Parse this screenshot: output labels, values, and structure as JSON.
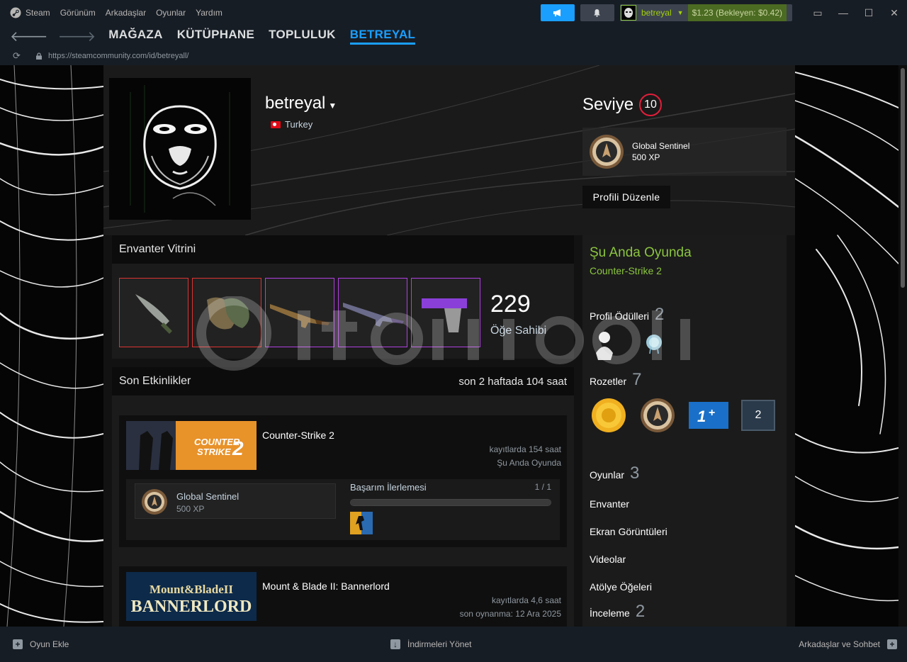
{
  "titlebar": {
    "menu": [
      "Steam",
      "Görünüm",
      "Arkadaşlar",
      "Oyunlar",
      "Yardım"
    ],
    "account_name": "betreyal",
    "wallet": "$1.23 (Bekleyen: $0.42)"
  },
  "nav": {
    "tabs": [
      "MAĞAZA",
      "KÜTÜPHANE",
      "TOPLULUK",
      "BETREYAL"
    ],
    "url": "https://steamcommunity.com/id/betreyall/"
  },
  "profile": {
    "name": "betreyal",
    "country": "Turkey",
    "level_label": "Seviye",
    "level": "10",
    "fav_badge_name": "Global Sentinel",
    "fav_badge_xp": "500 XP",
    "edit_button": "Profili Düzenle"
  },
  "showcase": {
    "title": "Envanter Vitrini",
    "count": "229",
    "count_label": "Öğe Sahibi"
  },
  "activity": {
    "title": "Son Etkinlikler",
    "summary": "son 2 haftada 104 saat",
    "games": [
      {
        "name": "Counter-Strike 2",
        "hours": "kayıtlarda 154 saat",
        "status": "Şu Anda Oyunda",
        "achievement_badge": "Global Sentinel",
        "achievement_xp": "500 XP",
        "achievement_title": "Başarım İlerlemesi",
        "achievement_count": "1 / 1",
        "achievement_progress": 1.0
      },
      {
        "name": "Mount & Blade II: Bannerlord",
        "hours": "kayıtlarda 4,6 saat",
        "status": "son oynanma: 12 Ara 2025"
      }
    ]
  },
  "sidebar": {
    "now_playing": "Şu Anda Oyunda",
    "now_game": "Counter-Strike 2",
    "awards_label": "Profil Ödülleri",
    "awards_count": "2",
    "badges_label": "Rozetler",
    "badges_count": "7",
    "badge_number": "2",
    "games_label": "Oyunlar",
    "games_count": "3",
    "inventory": "Envanter",
    "screenshots": "Ekran Görüntüleri",
    "videos": "Videolar",
    "workshop": "Atölye Öğeleri",
    "reviews": "İnceleme",
    "reviews_count": "2"
  },
  "bottom": {
    "add_game": "Oyun Ekle",
    "downloads": "İndirmeleri Yönet",
    "friends": "Arkadaşlar ve Sohbet"
  },
  "colors": {
    "accent": "#1a9fff",
    "ingame": "#8bc53f",
    "level_ring": "#e21e3a"
  }
}
